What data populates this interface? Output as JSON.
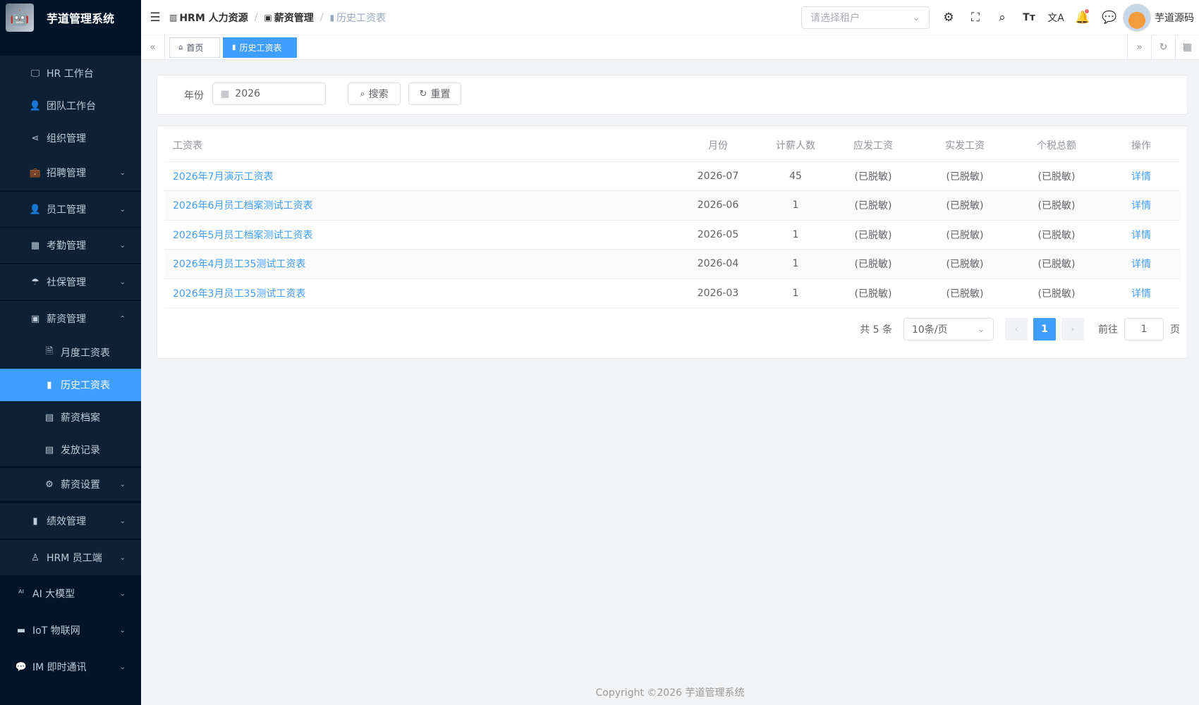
{
  "app": {
    "title": "芋道管理系统",
    "logo_icon": "robot-logo"
  },
  "sidebar": {
    "items": [
      {
        "label": "HR 工作台",
        "icon": "monitor-icon",
        "glyph": "🖵",
        "indent": 1,
        "arrow": ""
      },
      {
        "label": "团队工作台",
        "icon": "person-icon",
        "glyph": "👤",
        "indent": 1,
        "arrow": ""
      },
      {
        "label": "组织管理",
        "icon": "share-icon",
        "glyph": "⋖",
        "indent": 1,
        "arrow": ""
      },
      {
        "label": "招聘管理",
        "icon": "briefcase-icon",
        "glyph": "💼",
        "indent": 1,
        "arrow": "⌄"
      },
      {
        "label": "员工管理",
        "icon": "person-icon",
        "glyph": "👤",
        "indent": 1,
        "arrow": "⌄"
      },
      {
        "label": "考勤管理",
        "icon": "calendar-icon",
        "glyph": "▦",
        "indent": 1,
        "arrow": "⌄"
      },
      {
        "label": "社保管理",
        "icon": "umbrella-icon",
        "glyph": "☂",
        "indent": 1,
        "arrow": "⌄"
      },
      {
        "label": "薪资管理",
        "icon": "wallet-icon",
        "glyph": "▣",
        "indent": 1,
        "arrow": "⌃"
      },
      {
        "label": "月度工资表",
        "icon": "document-icon",
        "glyph": "🗎",
        "indent": 2,
        "arrow": ""
      },
      {
        "label": "历史工资表",
        "icon": "bar-chart-icon",
        "glyph": "▮",
        "indent": 2,
        "arrow": "",
        "active": true
      },
      {
        "label": "薪资档案",
        "icon": "archive-icon",
        "glyph": "▤",
        "indent": 2,
        "arrow": ""
      },
      {
        "label": "发放记录",
        "icon": "list-icon",
        "glyph": "▤",
        "indent": 2,
        "arrow": ""
      },
      {
        "label": "薪资设置",
        "icon": "gear-icon",
        "glyph": "⚙",
        "indent": 2,
        "arrow": "⌄"
      },
      {
        "label": "绩效管理",
        "icon": "bar-chart-icon",
        "glyph": "▮",
        "indent": 1,
        "arrow": "⌄"
      },
      {
        "label": "HRM 员工端",
        "icon": "user-outline-icon",
        "glyph": "♙",
        "indent": 1,
        "arrow": "⌄"
      },
      {
        "label": "AI 大模型",
        "icon": "ai-icon",
        "glyph": "ᴬᴵ",
        "indent": 0,
        "arrow": "⌄"
      },
      {
        "label": "IoT 物联网",
        "icon": "router-icon",
        "glyph": "▬",
        "indent": 0,
        "arrow": "⌄"
      },
      {
        "label": "IM 即时通讯",
        "icon": "chat-icon",
        "glyph": "💬",
        "indent": 0,
        "arrow": "⌄"
      }
    ]
  },
  "header": {
    "breadcrumb": [
      {
        "label": "HRM 人力资源",
        "icon": "building-icon"
      },
      {
        "label": "薪资管理",
        "icon": "wallet-icon"
      },
      {
        "label": "历史工资表",
        "icon": "bar-chart-icon"
      }
    ],
    "tenant_placeholder": "请选择租户",
    "icons": [
      "gear-icon",
      "fullscreen-icon",
      "search-icon",
      "font-size-icon",
      "translate-icon",
      "bell-icon",
      "message-icon"
    ],
    "user_name": "芋道源码"
  },
  "tags": [
    {
      "label": "首页",
      "icon": "home-icon"
    },
    {
      "label": "历史工资表",
      "icon": "bar-chart-icon",
      "active": true
    }
  ],
  "search": {
    "year_label": "年份",
    "year_value": "2026",
    "search_button": "搜索",
    "reset_button": "重置"
  },
  "table": {
    "headers": [
      "工资表",
      "月份",
      "计薪人数",
      "应发工资",
      "实发工资",
      "个税总额",
      "操作"
    ],
    "rows": [
      {
        "name": "2026年7月演示工资表",
        "month": "2026-07",
        "count": "45",
        "gross": "(已脱敏)",
        "net": "(已脱敏)",
        "tax": "(已脱敏)",
        "action": "详情"
      },
      {
        "name": "2026年6月员工档案测试工资表",
        "month": "2026-06",
        "count": "1",
        "gross": "(已脱敏)",
        "net": "(已脱敏)",
        "tax": "(已脱敏)",
        "action": "详情"
      },
      {
        "name": "2026年5月员工档案测试工资表",
        "month": "2026-05",
        "count": "1",
        "gross": "(已脱敏)",
        "net": "(已脱敏)",
        "tax": "(已脱敏)",
        "action": "详情"
      },
      {
        "name": "2026年4月员工35测试工资表",
        "month": "2026-04",
        "count": "1",
        "gross": "(已脱敏)",
        "net": "(已脱敏)",
        "tax": "(已脱敏)",
        "action": "详情"
      },
      {
        "name": "2026年3月员工35测试工资表",
        "month": "2026-03",
        "count": "1",
        "gross": "(已脱敏)",
        "net": "(已脱敏)",
        "tax": "(已脱敏)",
        "action": "详情"
      }
    ]
  },
  "pagination": {
    "total": "共 5 条",
    "page_size": "10条/页",
    "current_page": "1",
    "goto_label": "前往",
    "goto_value": "1",
    "page_suffix": "页"
  },
  "footer": {
    "copyright": "Copyright ©2026 芋道管理系统"
  },
  "colors": {
    "primary": "#409eff",
    "sidebar_bg": "#001529",
    "submenu_bg": "#0c2135"
  }
}
